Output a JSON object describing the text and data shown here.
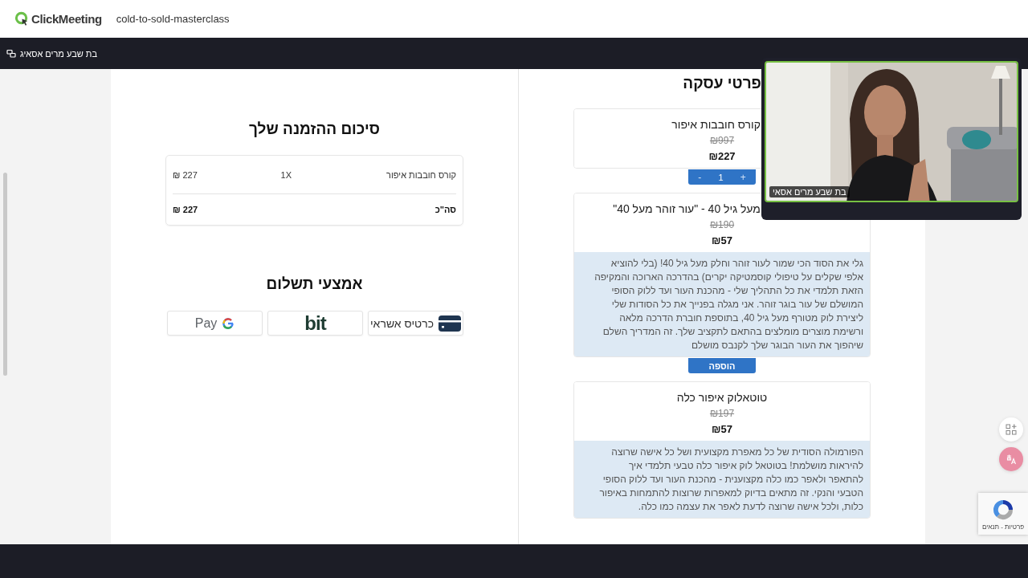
{
  "app": {
    "brand": "ClickMeeting",
    "room": "cold-to-sold-masterclass"
  },
  "presenter_bar": {
    "label": "בת שבע מרים אסאיג"
  },
  "video": {
    "kind": "picture",
    "name_label": "בת שבע מרים אסאי"
  },
  "order_summary": {
    "title": "סיכום ההזמנה שלך",
    "items": [
      {
        "name": "קורס חובבות איפור",
        "quantity": "1X",
        "price": "₪ 227"
      }
    ],
    "total_label": "סה\"כ",
    "total": "₪ 227"
  },
  "payment": {
    "title": "אמצעי תשלום",
    "methods": [
      {
        "kind": "card",
        "label": "כרטיס אשראי"
      },
      {
        "kind": "bit",
        "label": "bit"
      },
      {
        "kind": "gpay",
        "label": "Pay"
      }
    ]
  },
  "deal": {
    "title": "פרטי עסקה",
    "products": [
      {
        "title": "קורס חובבות איפור",
        "old_price": "₪997",
        "price": "₪227",
        "control": {
          "kind": "stepper",
          "minus": "-",
          "quantity": "1",
          "plus": "+"
        }
      },
      {
        "title": "מעל גיל 40 - \"עור זוהר מעל 40\"",
        "old_price": "₪190",
        "price": "₪57",
        "description": "גלי את הסוד הכי שמור לעור זוהר וחלק מעל גיל 40! (בלי להוציא אלפי שקלים על טיפולי קוסמטיקה יקרים) בהדרכה הארוכה והמקיפה הזאת תלמדי את כל התהליך שלי - מהכנת העור ועד ללוק הסופי המושלם של עור בוגר זוהר. אני מגלה בפנייך את כל הסודות שלי ליצירת לוק מטורף מעל גיל 40, בתוספת חוברת הדרכה מלאה ורשימת מוצרים מומלצים בהתאם לתקציב שלך. זה המדריך השלם שיהפוך את העור הבוגר שלך לקנבס מושלם",
        "control": {
          "kind": "add",
          "label": "הוספה"
        }
      },
      {
        "title": "טוטאלוק איפור כלה",
        "old_price": "₪197",
        "price": "₪57",
        "description": "הפורמולה הסודית של כל מאפרת מקצועית ושל כל אישה שרוצה להיראות מושלמת! בטוטאל לוק איפור כלה טבעי תלמדי איך להתאפר ולאפר כמו כלה מקצוענית - מהכנת העור ועד ללוק הסופי הטבעי והנקי. זה מתאים בדיוק למאפרות שרוצות להתמחות באיפור כלות, ולכל אישה שרוצה לדעת לאפר את עצמה כמו כלה."
      }
    ]
  },
  "recaptcha": {
    "links": "פרטיות - תנאים"
  }
}
